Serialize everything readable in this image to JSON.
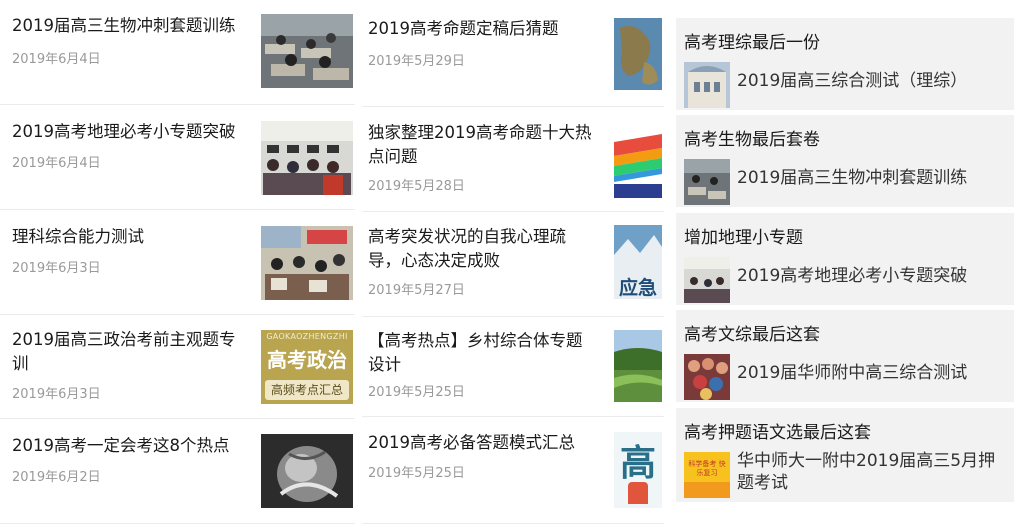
{
  "col1": [
    {
      "title": "2019届高三生物冲刺套题训练",
      "date": "2019年6月4日",
      "thumb": "classroom-photo"
    },
    {
      "title": "2019高考地理必考小专题突破",
      "date": "2019年6月4日",
      "thumb": "classroom-photo"
    },
    {
      "title": "理科综合能力测试",
      "date": "2019年6月3日",
      "thumb": "classroom-photo"
    },
    {
      "title": "2019届高三政治考前主观题专训",
      "date": "2019年6月3日",
      "thumb": "politics-banner"
    },
    {
      "title": "2019高考一定会考这8个热点",
      "date": "2019年6月2日",
      "thumb": "sculpture-photo"
    }
  ],
  "col2": [
    {
      "title": "2019高考命题定稿后猜题",
      "date": "2019年5月29日",
      "thumb": "globe-image"
    },
    {
      "title": "独家整理2019高考命题十大热点问题",
      "date": "2019年5月28日",
      "thumb": "diagram-image"
    },
    {
      "title": "高考突发状况的自我心理疏导，心态决定成败",
      "date": "2019年5月27日",
      "thumb": "emergency-image"
    },
    {
      "title": "【高考热点】乡村综合体专题设计",
      "date": "2019年5月25日",
      "thumb": "landscape-image"
    },
    {
      "title": "2019高考必备答题模式汇总",
      "date": "2019年5月25日",
      "thumb": "gao-character-image"
    }
  ],
  "politics_banner": {
    "top": "GAOKAOZHENGZHI",
    "main": "高考政治",
    "sub": "高频考点汇总"
  },
  "emergency_text": "应急",
  "gao_char": "高",
  "col3": [
    {
      "title": "高考理综最后一份",
      "sub": "2019届高三综合测试（理综）",
      "thumb": "building-photo"
    },
    {
      "title": "高考生物最后套卷",
      "sub": "2019届高三生物冲刺套题训练",
      "thumb": "classroom-photo"
    },
    {
      "title": "增加地理小专题",
      "sub": "2019高考地理必考小专题突破",
      "thumb": "classroom-photo"
    },
    {
      "title": "高考文综最后这套",
      "sub": "2019届华师附中高三综合测试",
      "thumb": "crowd-photo"
    },
    {
      "title": "高考押题语文选最后这套",
      "sub": "华中师大一附中2019届高三5月押题考试",
      "thumb": "yellow-book"
    }
  ],
  "yellow_book_text": "科学备考 快乐复习"
}
